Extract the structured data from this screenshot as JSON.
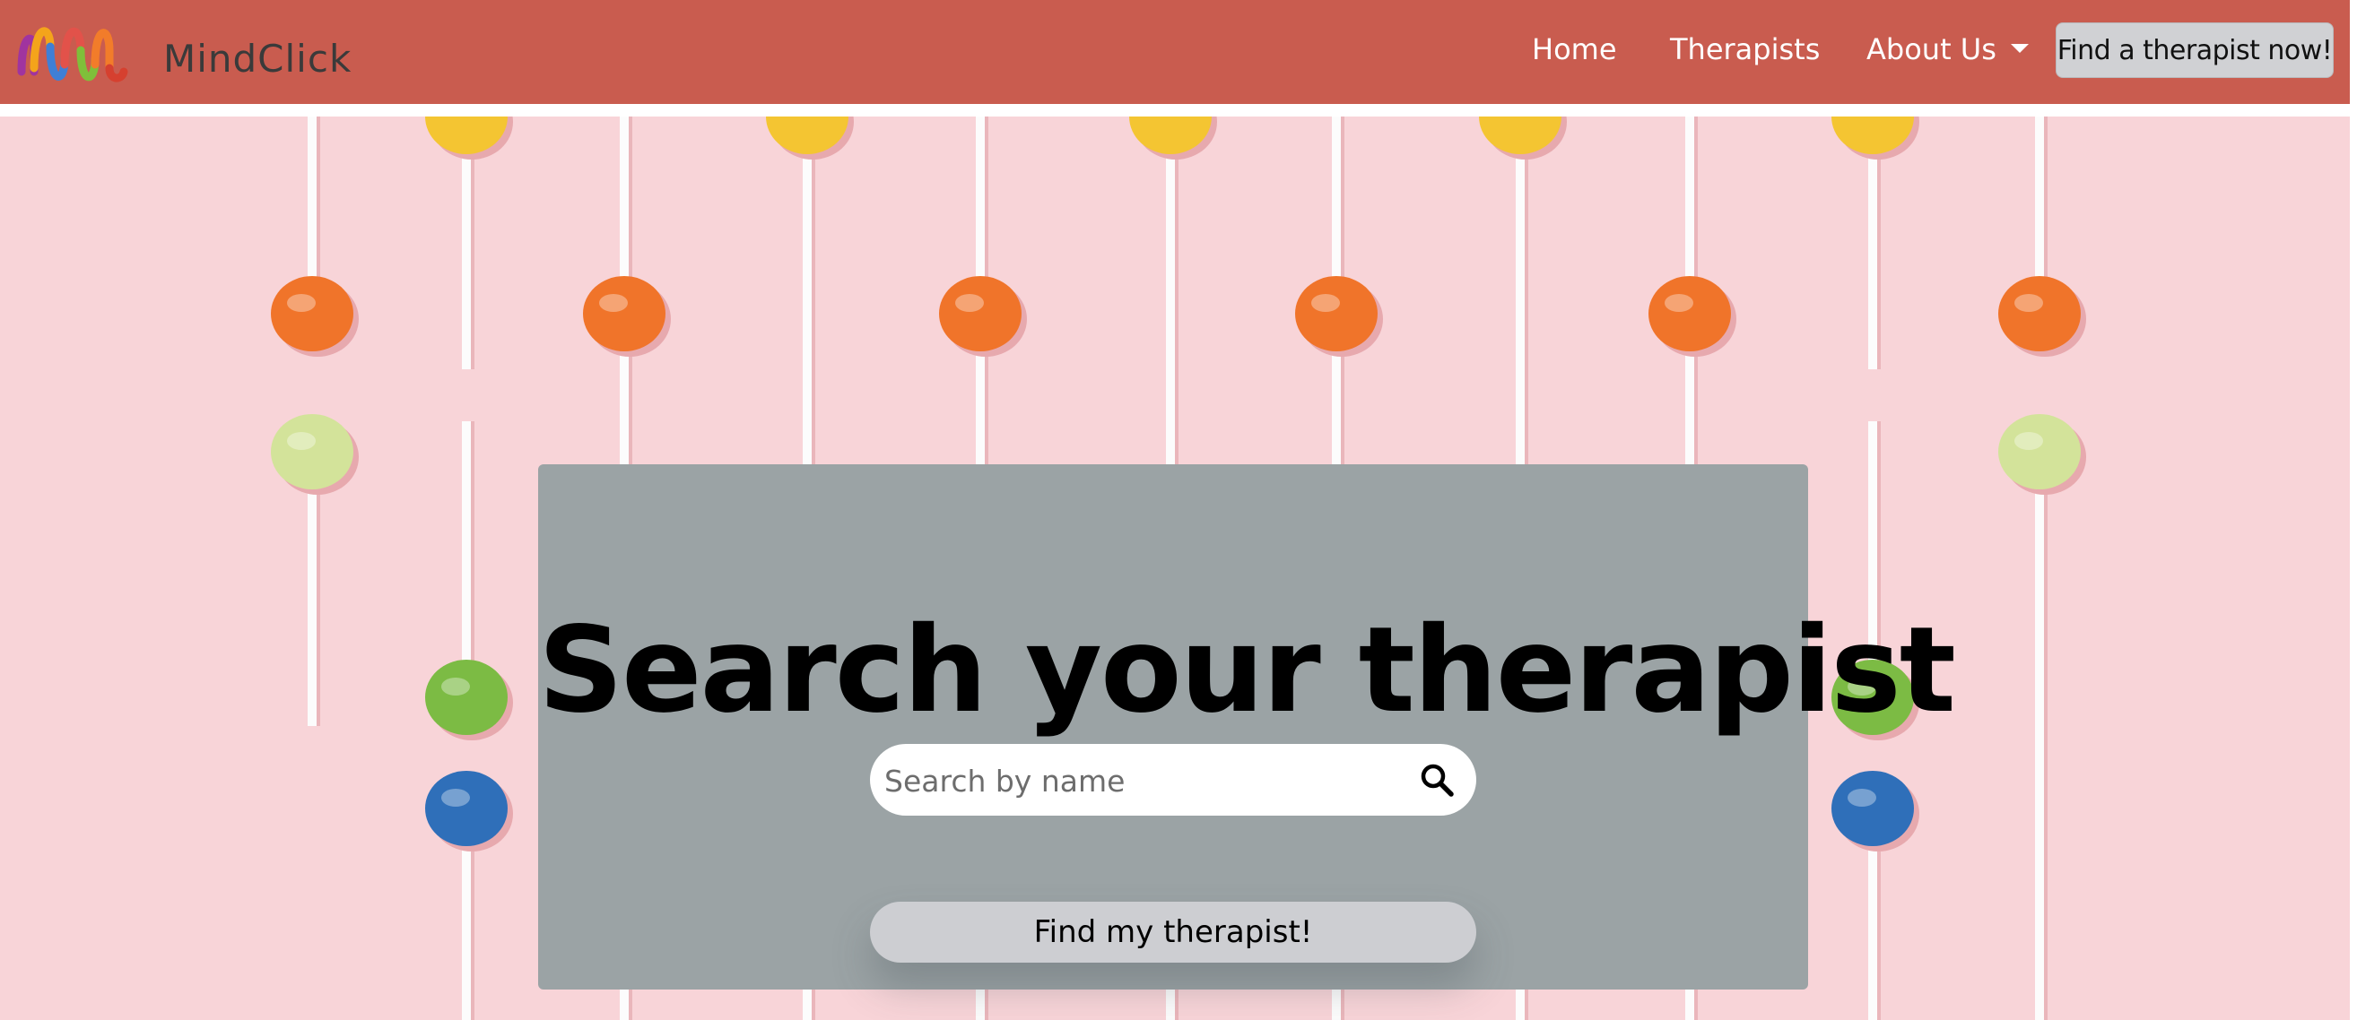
{
  "brand": {
    "name": "MindClick",
    "logo_icon": "colorful-wave-logo-icon"
  },
  "nav": {
    "links": [
      {
        "label": "Home"
      },
      {
        "label": "Therapists"
      },
      {
        "label": "About Us",
        "icon": "caret-down-icon"
      }
    ],
    "cta_label": "Find a therapist now!"
  },
  "hero": {
    "headline": "Search your therapist",
    "search": {
      "placeholder": "Search by name",
      "value": "",
      "icon": "magnifier-search-icon"
    },
    "find_button_label": "Find my therapist!",
    "background_image": "lollipops-pattern"
  },
  "colors": {
    "navbar": "#c95c4f",
    "hero_background": "#f8d4d8",
    "card": "#9ba3a5",
    "button": "#cdced2"
  }
}
